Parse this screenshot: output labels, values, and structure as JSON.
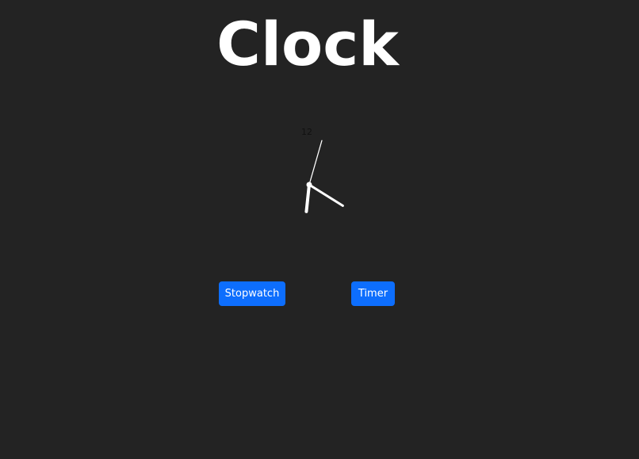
{
  "header": {
    "title": "Clock"
  },
  "clock": {
    "numeral_12": "12",
    "time": {
      "hour": 4,
      "minute": 4,
      "second": 32
    },
    "hand_color": "#ffffff",
    "numeral_color": "#111111"
  },
  "buttons": {
    "stopwatch_label": "Stopwatch",
    "timer_label": "Timer"
  },
  "colors": {
    "background": "#232323",
    "accent": "#0d6efd",
    "text": "#ffffff"
  }
}
